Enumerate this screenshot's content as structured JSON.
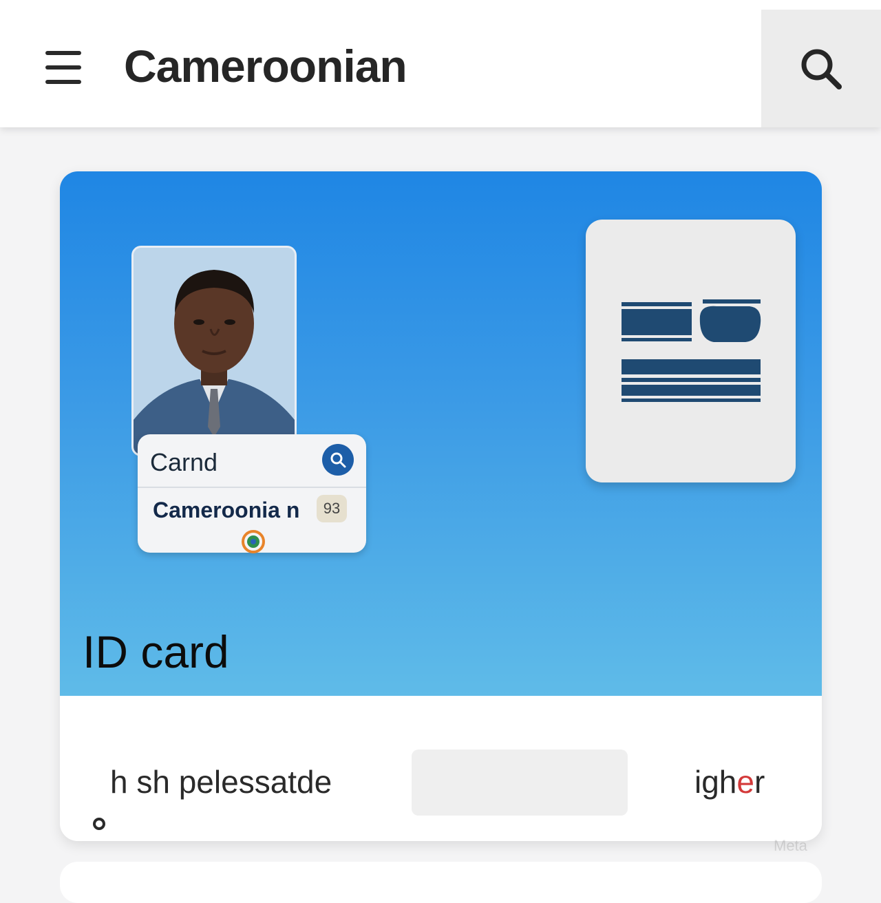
{
  "app_bar": {
    "title": "Cameroonian"
  },
  "card": {
    "hero_label": "ID card",
    "photo_panel": {
      "title": "Carnd",
      "country": "Cameroonia n",
      "badge": "93"
    },
    "footer": {
      "text": "h sh pelessatde",
      "action_prefix": "igh",
      "action_accent": "e",
      "action_suffix": "r"
    }
  },
  "watermark": "Meta",
  "colors": {
    "hero_top": "#1f86e4",
    "hero_bottom": "#5fbbe8",
    "doc_bars": "#1f4a72",
    "accent_red": "#d43a3a"
  }
}
